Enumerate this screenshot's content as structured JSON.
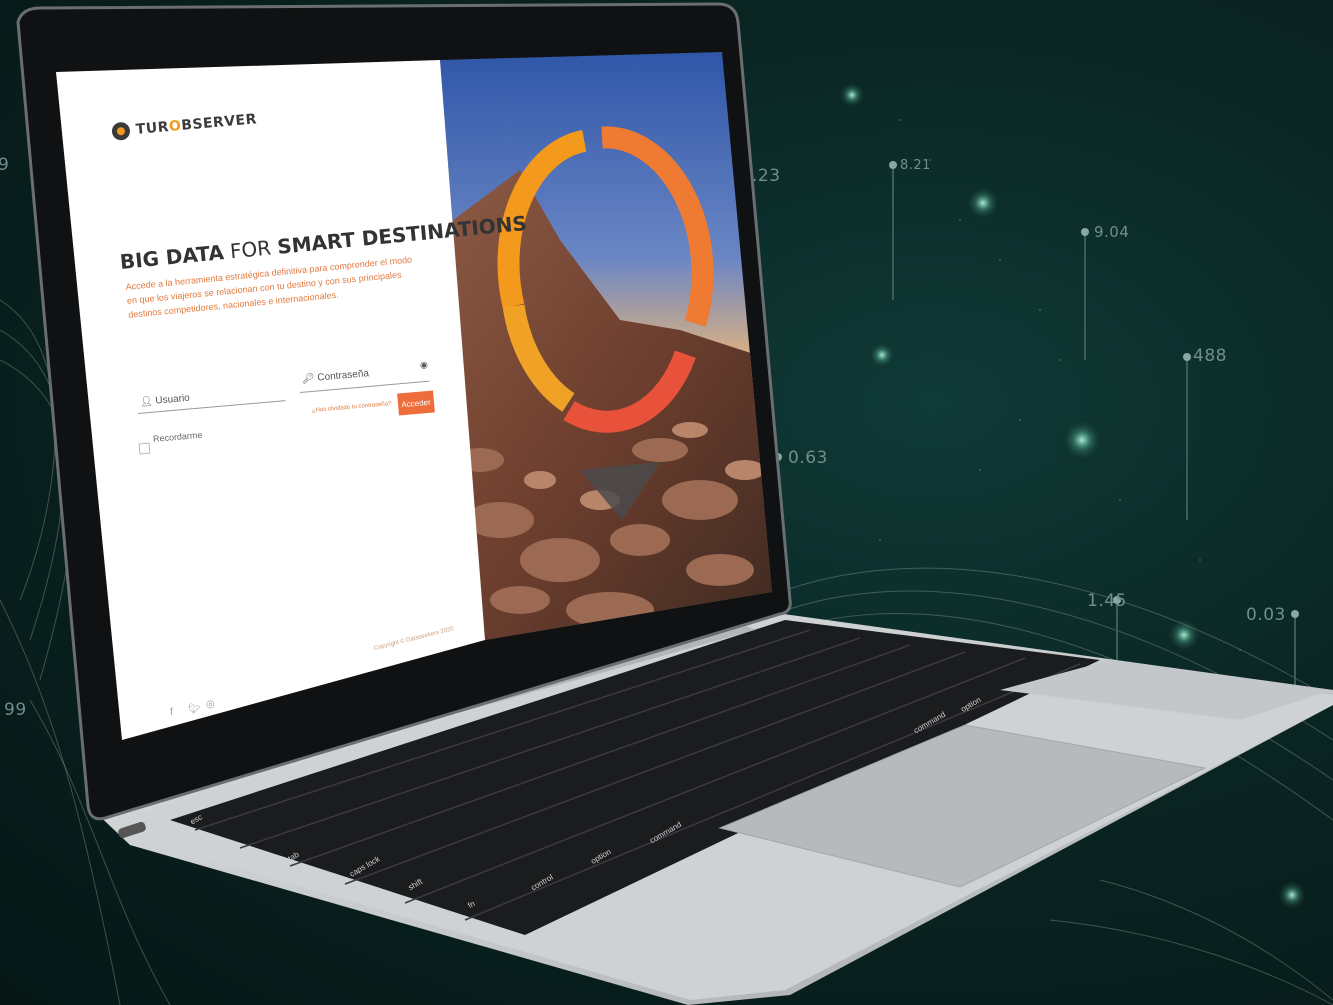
{
  "background": {
    "floating_values": [
      "9",
      ".23",
      "8.21",
      "9.04",
      "488",
      "0.63",
      "1.45",
      "0.03",
      "99"
    ],
    "accent": "#0f3a36"
  },
  "login": {
    "brand": {
      "pre": "TUR",
      "o": "O",
      "post": "BSERVER"
    },
    "headline": {
      "part1": "BIG DATA",
      "part2": " FOR ",
      "part3": "SMART DESTINATIONS"
    },
    "tagline": "Accede a la herramienta estratégica definitiva para comprender el modo en que los viajeros se relacionan con tu destino y con sus principales destinos competidores, nacionales e internacionales.",
    "username_placeholder": "Usuario",
    "password_placeholder": "Contraseña",
    "forgot": "¿Has olvidado tu contraseña?",
    "submit": "Acceder",
    "remember": "Recordarme",
    "copyright": "Copyright © Dataseekers 2020",
    "social_icons": [
      "facebook-icon",
      "twitter-icon",
      "dribbble-icon"
    ]
  },
  "keyboard": {
    "row_labels": [
      "esc",
      "tab",
      "caps lock",
      "shift",
      "fn",
      "control",
      "option",
      "command",
      "command",
      "option"
    ]
  },
  "colors": {
    "accent_orange": "#ef6c3b",
    "ring_orange": "#f39a1c",
    "ring_red": "#e8523a"
  }
}
